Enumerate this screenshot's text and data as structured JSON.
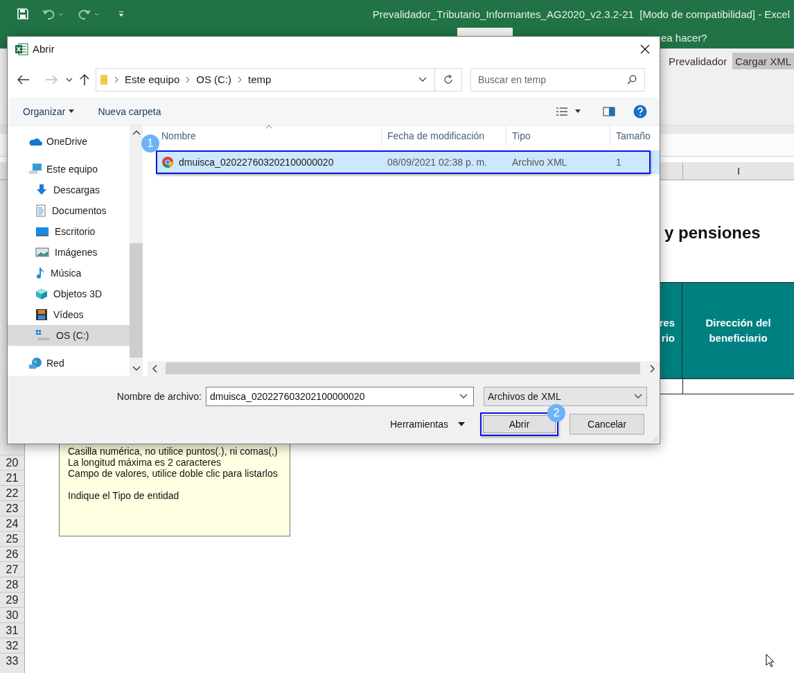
{
  "excel": {
    "title": "Prevalidador_Tributario_Informantes_AG2020_v2.3.2-21  [Modo de compatibilidad] - Excel",
    "tell_me": "ea hacer?",
    "ribbon_buttons": [
      {
        "label": "Prevalidador",
        "selected": false
      },
      {
        "label": "Cargar XML",
        "selected": true
      }
    ],
    "column_header": "I",
    "sheet_heading": "y pensiones",
    "table_headers": [
      {
        "lines": [
          "res",
          "rio"
        ]
      },
      {
        "lines": [
          "Dirección del",
          "beneficiario"
        ]
      }
    ],
    "row_numbers": [
      "20",
      "21",
      "22",
      "23",
      "24",
      "25",
      "26",
      "27",
      "28",
      "29",
      "30",
      "31",
      "32",
      "33"
    ],
    "note": {
      "lines": [
        "Casilla numérica, no utilice puntos(.), ni comas(,)",
        "La longitud máxima es 2 caracteres",
        "Campo de valores, utilice doble clic para listarlos"
      ],
      "instruction": "Indique el Tipo de entidad"
    }
  },
  "dialog": {
    "title": "Abrir",
    "path": [
      "Este equipo",
      "OS (C:)",
      "temp"
    ],
    "search": {
      "placeholder": "Buscar en temp"
    },
    "toolbar": [
      "Organizar",
      "Nueva carpeta"
    ],
    "nav_items": [
      {
        "label": "OneDrive",
        "selected": false
      },
      {
        "label": "Este equipo",
        "selected": false,
        "children": [
          {
            "label": "Descargas",
            "selected": false
          },
          {
            "label": "Documentos",
            "selected": false
          },
          {
            "label": "Escritorio",
            "selected": false
          },
          {
            "label": "Imágenes",
            "selected": false
          },
          {
            "label": "Música",
            "selected": false
          },
          {
            "label": "Objetos 3D",
            "selected": false
          },
          {
            "label": "Vídeos",
            "selected": false
          },
          {
            "label": "OS (C:)",
            "selected": true
          }
        ]
      },
      {
        "label": "Red",
        "selected": false
      }
    ],
    "columns": [
      "Nombre",
      "Fecha de modificación",
      "Tipo",
      "Tamaño"
    ],
    "files": [
      {
        "name": "dmuisca_020227603202100000020",
        "modified": "08/09/2021 02:38 p. m.",
        "type": "Archivo XML",
        "size": "1",
        "selected": true
      }
    ],
    "filename_label": "Nombre de archivo:",
    "filename": "dmuisca_020227603202100000020",
    "filter": "Archivos de XML",
    "tools": "Herramientas",
    "buttons": [
      {
        "label": "Abrir",
        "default": true
      },
      {
        "label": "Cancelar",
        "default": false
      }
    ]
  },
  "annotations": [
    {
      "label": "1"
    },
    {
      "label": "2"
    }
  ]
}
